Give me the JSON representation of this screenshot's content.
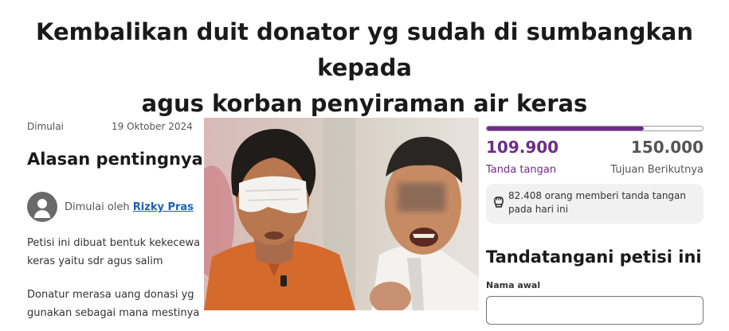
{
  "page": {
    "title_line1": "Kembalikan duit donator yg sudah di sumbangkan kepada",
    "title_line2": "agus korban penyiraman air keras"
  },
  "meta": {
    "started_label": "Dimulai",
    "started_date": "19 Oktober 2024"
  },
  "section": {
    "heading": "Alasan pentingnya p"
  },
  "author": {
    "prefix": "Dimulai oleh",
    "name": "Rizky Pras"
  },
  "body": {
    "para1_line1": "Petisi ini dibuat bentuk kekecewa",
    "para1_line2": "keras yaitu sdr agus salim",
    "para2_line1": "Donatur merasa uang donasi yg",
    "para2_line2": "gunakan sebagai mana mestinya"
  },
  "progress": {
    "current": "109.900",
    "goal": "150.000",
    "current_label": "Tanda tangan",
    "goal_label": "Tujuan Berikutnya",
    "fraction": 0.727,
    "color": "#6e2c8a"
  },
  "activity": {
    "icon": "fist-icon",
    "line1": "82.408 orang memberi tanda tangan",
    "line2": "pada hari ini"
  },
  "sign_form": {
    "heading": "Tandatangani petisi ini",
    "first_name_label": "Nama awal",
    "first_name_value": ""
  }
}
